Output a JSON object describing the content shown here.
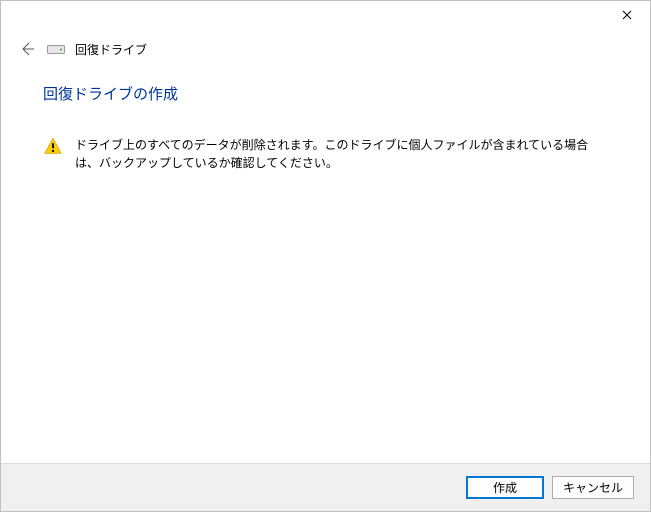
{
  "window": {
    "breadcrumb": "回復ドライブ"
  },
  "page": {
    "title": "回復ドライブの作成",
    "warning": "ドライブ上のすべてのデータが削除されます。このドライブに個人ファイルが含まれている場合は、バックアップしているか確認してください。"
  },
  "footer": {
    "primary_label": "作成",
    "cancel_label": "キャンセル"
  }
}
